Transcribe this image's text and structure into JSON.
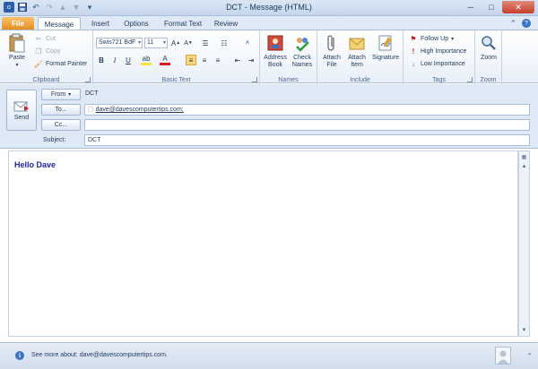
{
  "window": {
    "title": "DCT  -  Message (HTML)"
  },
  "tabs": [
    {
      "label": "File"
    },
    {
      "label": "Message"
    },
    {
      "label": "Insert"
    },
    {
      "label": "Options"
    },
    {
      "label": "Format Text"
    },
    {
      "label": "Review"
    }
  ],
  "ribbon": {
    "clipboard": {
      "paste": "Paste",
      "cut": "Cut",
      "copy": "Copy",
      "format_painter": "Format Painter",
      "label": "Clipboard"
    },
    "basic_text": {
      "font": "Swis721 BdF",
      "size": "11",
      "label": "Basic Text"
    },
    "names": {
      "address_book": "Address Book",
      "check_names": "Check Names",
      "label": "Names"
    },
    "include": {
      "attach_file": "Attach File",
      "attach_item": "Attach Item",
      "signature": "Signature",
      "label": "Include"
    },
    "tags": {
      "follow_up": "Follow Up",
      "high_importance": "High Importance",
      "low_importance": "Low Importance",
      "label": "Tags"
    },
    "zoom": {
      "zoom": "Zoom",
      "label": "Zoom"
    }
  },
  "header": {
    "send": "Send",
    "from_button": "From",
    "from_value": "DCT",
    "to_button": "To...",
    "to_value": "dave@davescomputertips.com;",
    "cc_button": "Cc...",
    "cc_value": "",
    "subject_label": "Subject:",
    "subject_value": "DCT"
  },
  "body": {
    "text": "Hello Dave"
  },
  "status": {
    "see_more": "See more about: dave@davescomputertips.com."
  },
  "colors": {
    "accent": "#dfe9f5",
    "file_tab": "#e38a1b",
    "body_text": "#1f1f9f"
  }
}
